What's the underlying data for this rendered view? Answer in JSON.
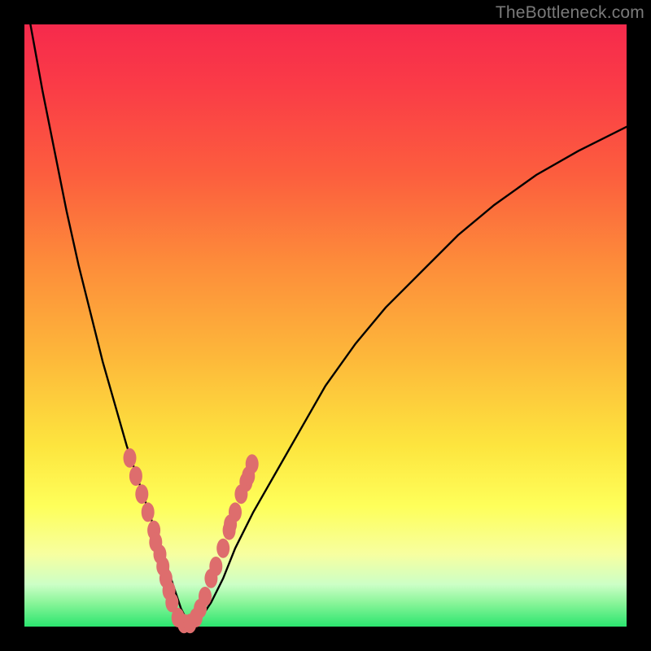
{
  "watermark": "TheBottleneck.com",
  "colors": {
    "curve": "#000000",
    "dot_fill": "#de6d6d",
    "dot_stroke": "#c95a5a"
  },
  "chart_data": {
    "type": "line",
    "title": "",
    "xlabel": "",
    "ylabel": "",
    "xlim": [
      0,
      100
    ],
    "ylim": [
      0,
      100
    ],
    "grid": false,
    "series": [
      {
        "name": "bottleneck-curve",
        "x": [
          1,
          3,
          5,
          7,
          9,
          11,
          13,
          15,
          17,
          19,
          21,
          23,
          24,
          25,
          26,
          27,
          28,
          29,
          31,
          33,
          35,
          38,
          42,
          46,
          50,
          55,
          60,
          66,
          72,
          78,
          85,
          92,
          100
        ],
        "y": [
          100,
          89,
          79,
          69,
          60,
          52,
          44,
          37,
          30,
          24,
          18,
          12,
          9,
          6,
          3,
          1,
          0,
          1,
          4,
          8,
          13,
          19,
          26,
          33,
          40,
          47,
          53,
          59,
          65,
          70,
          75,
          79,
          83
        ]
      }
    ],
    "points": [
      {
        "x": 17.5,
        "y": 28
      },
      {
        "x": 18.5,
        "y": 25
      },
      {
        "x": 19.5,
        "y": 22
      },
      {
        "x": 20.5,
        "y": 19
      },
      {
        "x": 21.5,
        "y": 16
      },
      {
        "x": 21.8,
        "y": 14
      },
      {
        "x": 22.5,
        "y": 12
      },
      {
        "x": 23.0,
        "y": 10
      },
      {
        "x": 23.5,
        "y": 8
      },
      {
        "x": 24.0,
        "y": 6
      },
      {
        "x": 24.5,
        "y": 4
      },
      {
        "x": 25.5,
        "y": 1.5
      },
      {
        "x": 26.5,
        "y": 0.5
      },
      {
        "x": 27.5,
        "y": 0.5
      },
      {
        "x": 28.5,
        "y": 1.5
      },
      {
        "x": 29.2,
        "y": 3
      },
      {
        "x": 30.0,
        "y": 5
      },
      {
        "x": 31.0,
        "y": 8
      },
      {
        "x": 31.8,
        "y": 10
      },
      {
        "x": 33.0,
        "y": 13
      },
      {
        "x": 34.0,
        "y": 16
      },
      {
        "x": 34.2,
        "y": 17
      },
      {
        "x": 35.0,
        "y": 19
      },
      {
        "x": 36.0,
        "y": 22
      },
      {
        "x": 36.8,
        "y": 24
      },
      {
        "x": 37.2,
        "y": 25
      },
      {
        "x": 37.8,
        "y": 27
      }
    ]
  }
}
